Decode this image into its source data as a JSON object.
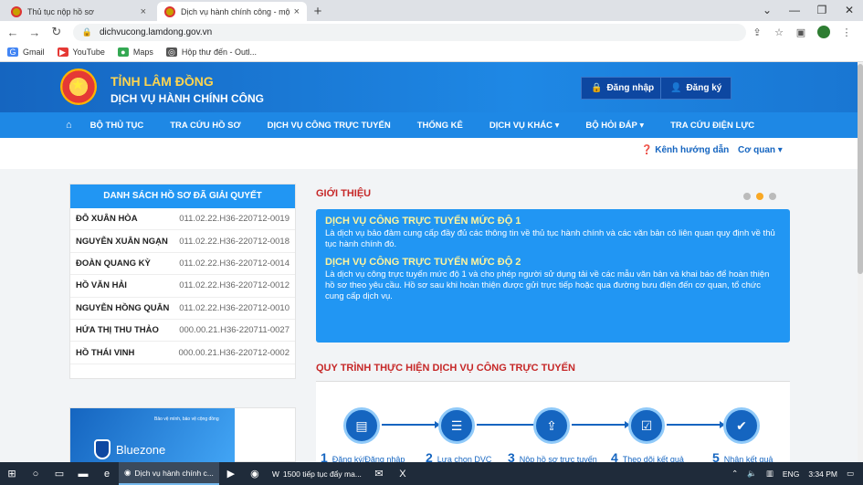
{
  "browser": {
    "tabs": [
      {
        "title": "Thủ tục nộp hồ sơ",
        "close": "×"
      },
      {
        "title": "Dịch vụ hành chính công - một cửa",
        "close": "×"
      }
    ],
    "new_tab": "+",
    "window_controls": [
      "⌄",
      "—",
      "❐",
      "✕"
    ],
    "url": "dichvucong.lamdong.gov.vn",
    "bookmarks": [
      "Gmail",
      "YouTube",
      "Maps",
      "Hộp thư đến - Outl..."
    ]
  },
  "header": {
    "province": "TỈNH LÂM ĐỒNG",
    "service": "DỊCH VỤ HÀNH CHÍNH CÔNG",
    "login": "Đăng nhập",
    "register": "Đăng ký"
  },
  "menu": {
    "items": [
      "BỘ THỦ TỤC",
      "TRA CỨU HỒ SƠ",
      "DỊCH VỤ CÔNG TRỰC TUYẾN",
      "THỐNG KÊ",
      "DỊCH VỤ KHÁC ▾",
      "BỘ HỎI ĐÁP ▾",
      "TRA CỨU ĐIỆN LỰC"
    ]
  },
  "subbar": {
    "guide": "Kênh hướng dẫn",
    "org": "Cơ quan ▾"
  },
  "resolved": {
    "title": "DANH SÁCH HỒ SƠ ĐÃ GIẢI QUYẾT",
    "rows": [
      {
        "name": "ĐỖ XUÂN HÒA",
        "code": "011.02.22.H36-220712-0019"
      },
      {
        "name": "NGUYỄN XUÂN NGẠN",
        "code": "011.02.22.H36-220712-0018"
      },
      {
        "name": "ĐOÀN QUANG KỲ",
        "code": "011.02.22.H36-220712-0014"
      },
      {
        "name": "HỒ VĂN HẢI",
        "code": "011.02.22.H36-220712-0012"
      },
      {
        "name": "NGUYỄN HỒNG QUÂN",
        "code": "011.02.22.H36-220712-0010"
      },
      {
        "name": "HỨA THỊ THU THẢO",
        "code": "000.00.21.H36-220711-0027"
      },
      {
        "name": "HỒ THÁI VINH",
        "code": "000.00.21.H36-220712-0002"
      }
    ]
  },
  "banner": {
    "name": "Bluezone",
    "tagline": "Bảo vệ mình, bảo vệ cộng đồng"
  },
  "intro": {
    "title": "GIỚI THIỆU",
    "level1_title": "DỊCH VỤ CÔNG TRỰC TUYẾN MỨC ĐỘ 1",
    "level1_text": "Là dịch vụ bảo đảm cung cấp đầy đủ các thông tin về thủ tục hành chính và các văn bản có liên quan quy định về thủ tục hành chính đó.",
    "level2_title": "DỊCH VỤ CÔNG TRỰC TUYẾN MỨC ĐỘ 2",
    "level2_text": "Là dịch vụ công trực tuyến mức độ 1 và cho phép người sử dụng tải về các mẫu văn bản và khai báo để hoàn thiện hồ sơ theo yêu cầu. Hồ sơ sau khi hoàn thiện được gửi trực tiếp hoặc qua đường bưu điện đến cơ quan, tổ chức cung cấp dịch vụ."
  },
  "process": {
    "title": "QUY TRÌNH THỰC HIỆN DỊCH VỤ CÔNG TRỰC TUYẾN",
    "steps": [
      {
        "num": "1",
        "label": "Đăng ký/Đăng nhập"
      },
      {
        "num": "2",
        "label": "Lựa chọn DVC"
      },
      {
        "num": "3",
        "label": "Nộp hồ sơ trực tuyến"
      },
      {
        "num": "4",
        "label": "Theo dõi kết quả"
      },
      {
        "num": "5",
        "label": "Nhận kết quả"
      }
    ]
  },
  "taskbar": {
    "apps": [
      "Dịch vụ hành chính c...",
      "1500 tiếp tục đẩy ma..."
    ],
    "lang": "ENG",
    "time": "3:34 PM"
  }
}
